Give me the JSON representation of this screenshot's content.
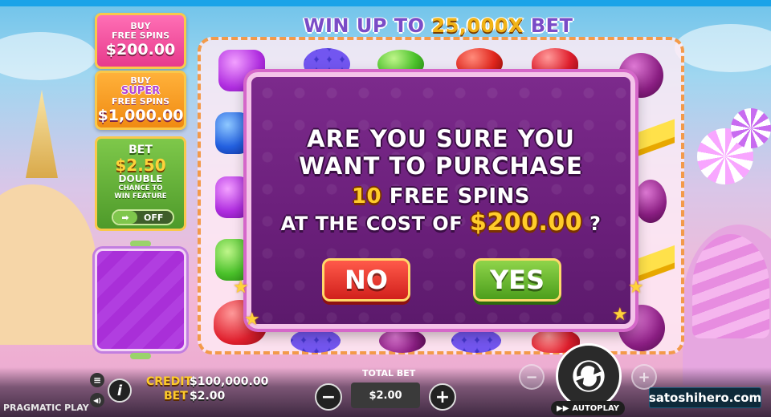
{
  "title": {
    "prefix": "WIN UP TO ",
    "highlight": "25,000X",
    "suffix": " BET"
  },
  "left_panel": {
    "buy_free_spins": {
      "line1": "BUY",
      "line2": "FREE SPINS",
      "price": "$200.00"
    },
    "buy_super": {
      "line1": "BUY",
      "line2": "SUPER",
      "line3": "FREE SPINS",
      "price": "$1,000.00"
    },
    "bet_feature": {
      "label": "BET",
      "amount": "$2.50",
      "line1": "DOUBLE",
      "line2": "CHANCE TO",
      "line3": "WIN FEATURE",
      "toggle_state": "OFF",
      "toggle_arrow": "➡"
    }
  },
  "dialog": {
    "line1": "ARE YOU SURE YOU",
    "line2": "WANT TO PURCHASE",
    "count": "10",
    "line3_rest": " FREE SPINS",
    "line4_prefix": "AT THE COST OF ",
    "cost": "$200.00",
    "line4_suffix": " ?",
    "no_label": "NO",
    "yes_label": "YES"
  },
  "hud": {
    "credit_label": "CREDIT",
    "credit_value": "$100,000.00",
    "bet_label": "BET",
    "bet_value": "$2.00",
    "total_bet_label": "TOTAL BET",
    "total_bet_value": "$2.00",
    "minus": "−",
    "plus": "+",
    "info": "i",
    "menu": "≡",
    "sound": "◀)",
    "autoplay_label": "AUTOPLAY",
    "autoplay_icon": "▶▶"
  },
  "branding": {
    "site": "satoshihero.com",
    "provider": "PRAGMATIC PLAY"
  },
  "colors": {
    "accent_gold": "#ffcc2a",
    "no_red": "#d1201c",
    "yes_green": "#4c9e1c",
    "dialog_purple": "#6a1f7a"
  }
}
